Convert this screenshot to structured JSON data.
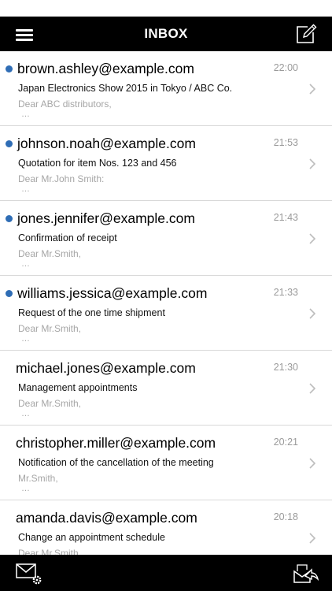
{
  "header": {
    "title": "INBOX",
    "menu_icon": "hamburger-menu-icon",
    "compose_icon": "compose-icon"
  },
  "messages": [
    {
      "sender": "brown.ashley@example.com",
      "time": "22:00",
      "subject": "Japan Electronics Show 2015 in Tokyo / ABC Co.",
      "preview": "Dear ABC distributors,",
      "more": "…",
      "unread": true
    },
    {
      "sender": "johnson.noah@example.com",
      "time": "21:53",
      "subject": "Quotation for item Nos. 123 and 456",
      "preview": "Dear Mr.John Smith:",
      "more": "…",
      "unread": true
    },
    {
      "sender": "jones.jennifer@example.com",
      "time": "21:43",
      "subject": "Confirmation of receipt",
      "preview": "Dear Mr.Smith,",
      "more": "…",
      "unread": true
    },
    {
      "sender": "williams.jessica@example.com",
      "time": "21:33",
      "subject": "Request of the one time shipment",
      "preview": "Dear Mr.Smith,",
      "more": "…",
      "unread": true
    },
    {
      "sender": "michael.jones@example.com",
      "time": "21:30",
      "subject": "Management appointments",
      "preview": "Dear Mr.Smith,",
      "more": "…",
      "unread": false
    },
    {
      "sender": "christopher.miller@example.com",
      "time": "20:21",
      "subject": "Notification of the cancellation of the meeting",
      "preview": "Mr.Smith,",
      "more": "…",
      "unread": false
    },
    {
      "sender": "amanda.davis@example.com",
      "time": "20:18",
      "subject": "Change an appointment schedule",
      "preview": "Dear Mr.Smith,",
      "more": "…",
      "unread": false
    }
  ],
  "toolbar": {
    "left_icon": "mail-settings-icon",
    "right_icon": "reply-all-icon"
  },
  "colors": {
    "bar_background": "#000000",
    "unread_dot": "#2f6db5",
    "time_text": "#9a9a9a",
    "preview_text": "#a6a6a6",
    "divider": "#d9d9d9"
  }
}
